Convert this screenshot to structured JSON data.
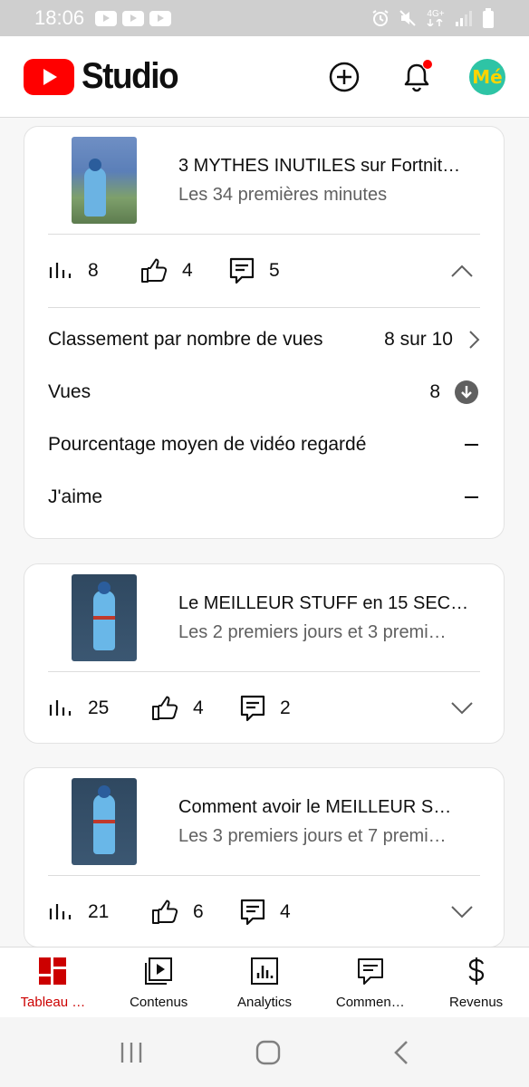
{
  "status_bar": {
    "time": "18:06",
    "network": "4G+"
  },
  "header": {
    "brand": "Studio",
    "colors": {
      "brand_red": "#ff0000",
      "text": "#0f0f0f"
    },
    "avatar_text": "Mé"
  },
  "cards": [
    {
      "title": "3 MYTHES INUTILES sur Fortnit…",
      "subtitle": "Les 34 premières minutes",
      "views": "8",
      "likes": "4",
      "comments": "5",
      "expanded": true,
      "details": [
        {
          "label": "Classement par nombre de vues",
          "value": "8 sur 10"
        },
        {
          "label": "Vues",
          "value": "8"
        },
        {
          "label": "Pourcentage moyen de vidéo regardé",
          "value": "—"
        },
        {
          "label": "J'aime",
          "value": "—"
        }
      ]
    },
    {
      "title": "Le MEILLEUR STUFF en 15 SEC…",
      "subtitle": "Les 2 premiers jours et 3 premi…",
      "views": "25",
      "likes": "4",
      "comments": "2",
      "expanded": false
    },
    {
      "title": "Comment avoir le MEILLEUR S…",
      "subtitle": "Les 3 premiers jours et 7 premi…",
      "views": "21",
      "likes": "6",
      "comments": "4",
      "expanded": false
    }
  ],
  "bottom_nav": {
    "items": [
      {
        "label": "Tableau …",
        "icon": "dashboard-icon",
        "active": true
      },
      {
        "label": "Contenus",
        "icon": "content-icon",
        "active": false
      },
      {
        "label": "Analytics",
        "icon": "analytics-icon",
        "active": false
      },
      {
        "label": "Commen…",
        "icon": "comments-icon",
        "active": false
      },
      {
        "label": "Revenus",
        "icon": "dollar-icon",
        "active": false
      }
    ],
    "active_color": "#cc0000"
  }
}
